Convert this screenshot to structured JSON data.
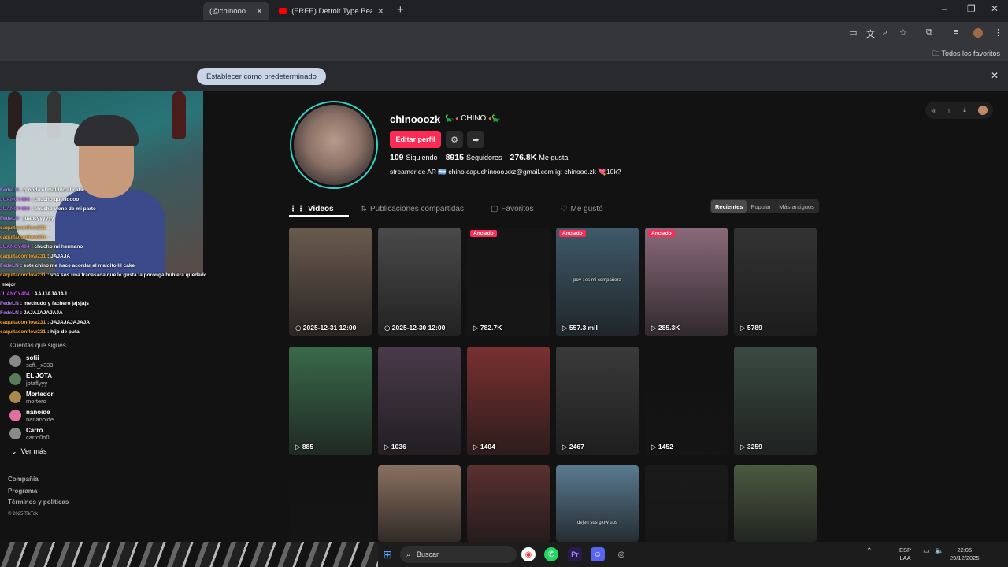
{
  "browser": {
    "tabs": [
      {
        "label": "(@chinooo",
        "active": true
      },
      {
        "label": "(FREE) Detroit Type Beat x Yn Ja",
        "active": false
      }
    ],
    "bookmarks_label": "Todos los favoritos",
    "infobar_button": "Establecer como predeterminado"
  },
  "chat": [
    {
      "user": "FedeLN",
      "msg": ": q onda el maldito lil cake",
      "color": "#b07cf0"
    },
    {
      "user": "JUANCY404",
      "msg": ": chucho queridooo",
      "color": "#c04cf0"
    },
    {
      "user": "JUANCY404",
      "msg": ": chucho viene de mi parte",
      "color": "#c04cf0"
    },
    {
      "user": "FedeLN",
      "msg": ": juancyyyyyy",
      "color": "#b07cf0"
    },
    {
      "user": "caquitaconflow231",
      "msg": ": ",
      "color": "#f0a030"
    },
    {
      "user": "caquitaconflow231",
      "msg": ": ",
      "color": "#f0a030"
    },
    {
      "user": "JUANCY404",
      "msg": ": chucho mi hermano",
      "color": "#c04cf0"
    },
    {
      "user": "caquitaconflow231",
      "msg": ": JAJAJA",
      "color": "#f0a030"
    },
    {
      "user": "FedeLN",
      "msg": ": este chino me hace acordar al maldito lil cake",
      "color": "#b07cf0"
    },
    {
      "user": "caquitaconflow231",
      "msg": ": vos sos una fracasada que le gusta la poronga hubiera quedado",
      "color": "#f0a030"
    },
    {
      "user": "",
      "msg": "mejor",
      "color": "#f0a030"
    },
    {
      "user": "JUANCY404",
      "msg": ": AAJJAJAJAJ",
      "color": "#c04cf0"
    },
    {
      "user": "FedeLN",
      "msg": ": mechudo y fachero jajsjajs",
      "color": "#b07cf0"
    },
    {
      "user": "FedeLN",
      "msg": ": JAJAJAJAJAJA",
      "color": "#b07cf0"
    },
    {
      "user": "caquitaconflow231",
      "msg": ": JAJAJAJAJAJA",
      "color": "#f0a030"
    },
    {
      "user": "caquitaconflow231",
      "msg": ": hijo de puta",
      "color": "#f0a030"
    }
  ],
  "sidebar": {
    "following_title": "Cuentas que sigues",
    "following": [
      {
        "name": "sofii",
        "handle": "soff._x333"
      },
      {
        "name": "EL JOTA",
        "handle": "jotaflyyy"
      },
      {
        "name": "Mortedor",
        "handle": "mortero"
      },
      {
        "name": "nanoide",
        "handle": "nananoide"
      },
      {
        "name": "Carro",
        "handle": "carro0o0"
      }
    ],
    "see_more": "Ver más",
    "footer": [
      "Compañía",
      "Programa",
      "Términos y políticas"
    ],
    "copyright": "© 2025 TikTok"
  },
  "profile": {
    "username": "chinooozk",
    "nickname": "CHINO",
    "edit_button": "Editar perfil",
    "stats": [
      {
        "value": "109",
        "label": "Siguiendo"
      },
      {
        "value": "8915",
        "label": "Seguidores"
      },
      {
        "value": "276.8K",
        "label": "Me gusta"
      }
    ],
    "bio": "streamer de AR 🇦🇷 chino.capuchinooo.xkz@gmail.com ig: chinooo.zk 💘10k?"
  },
  "tabs": {
    "videos": "Videos",
    "shared": "Publicaciones compartidas",
    "favorites": "Favoritos",
    "liked": "Me gustó"
  },
  "sort": {
    "recent": "Recientes",
    "popular": "Popular",
    "oldest": "Más antiguos"
  },
  "videos": [
    {
      "views": "2025-12-31 12:00",
      "pinned": "",
      "caption": "",
      "bg": "#6a5a4e"
    },
    {
      "views": "2025-12-30 12:00",
      "pinned": "",
      "caption": "",
      "bg": "#4a4a4a"
    },
    {
      "views": "782.7K",
      "pinned": "Anclado",
      "caption": "",
      "bg": "#151515"
    },
    {
      "views": "557.3 mil",
      "pinned": "Anclado",
      "caption": "pov : es mi compañera",
      "bg": "#3f5a6a"
    },
    {
      "views": "285.3K",
      "pinned": "Anclado",
      "caption": "",
      "bg": "#8a6a7a"
    },
    {
      "views": "5789",
      "pinned": "",
      "caption": "",
      "bg": "#333333"
    },
    {
      "views": "885",
      "pinned": "",
      "caption": "",
      "bg": "#3a6a4a"
    },
    {
      "views": "1036",
      "pinned": "",
      "caption": "",
      "bg": "#4a3a4a"
    },
    {
      "views": "1404",
      "pinned": "",
      "caption": "",
      "bg": "#7a3030"
    },
    {
      "views": "2467",
      "pinned": "",
      "caption": "",
      "bg": "#3a3a3a"
    },
    {
      "views": "1452",
      "pinned": "",
      "caption": "",
      "bg": "#111111"
    },
    {
      "views": "3259",
      "pinned": "",
      "caption": "",
      "bg": "#3a4a42"
    },
    {
      "views": "",
      "pinned": "",
      "caption": "",
      "bg": "#121212"
    },
    {
      "views": "",
      "pinned": "",
      "caption": "",
      "bg": "#8a7060"
    },
    {
      "views": "",
      "pinned": "",
      "caption": "",
      "bg": "#5a3030"
    },
    {
      "views": "",
      "pinned": "",
      "caption": "dejen sus glow ups",
      "bg": "#5a7a90"
    },
    {
      "views": "",
      "pinned": "",
      "caption": "",
      "bg": "#1a1a1a"
    },
    {
      "views": "",
      "pinned": "",
      "caption": "",
      "bg": "#4a5a40"
    }
  ],
  "taskbar": {
    "search": "Buscar",
    "lang": "ESP",
    "lang2": "LAA",
    "time": "22:05",
    "date": "29/12/2025"
  },
  "colors": {
    "accent": "#fe2c55",
    "ring": "#36d1c4"
  }
}
